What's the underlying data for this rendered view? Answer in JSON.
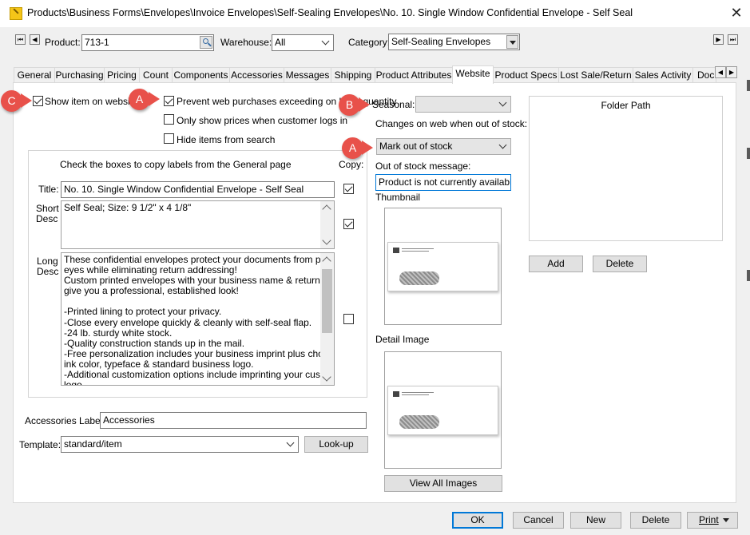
{
  "window": {
    "title": "Products\\Business Forms\\Envelopes\\Invoice Envelopes\\Self-Sealing Envelopes\\No. 10. Single Window Confidential Envelope - Self Seal"
  },
  "toolbar": {
    "product_label": "Product:",
    "product_value": "713-1",
    "warehouse_label": "Warehouse:",
    "warehouse_value": "All",
    "category_label": "Category:",
    "category_value": "Self-Sealing Envelopes"
  },
  "tabs": [
    {
      "label": "General"
    },
    {
      "label": "Purchasing"
    },
    {
      "label": "Pricing"
    },
    {
      "label": "Count"
    },
    {
      "label": "Components"
    },
    {
      "label": "Accessories"
    },
    {
      "label": "Messages"
    },
    {
      "label": "Shipping"
    },
    {
      "label": "Product Attributes"
    },
    {
      "label": "Website",
      "active": true
    },
    {
      "label": "Product Specs"
    },
    {
      "label": "Lost Sale/Return"
    },
    {
      "label": "Sales Activity"
    },
    {
      "label": "Doc"
    }
  ],
  "website": {
    "show_item": {
      "label": "Show item on website",
      "checked": true
    },
    "prevent_purchases": {
      "label": "Prevent web purchases exceeding on hand quantity",
      "checked": true
    },
    "only_prices": {
      "label": "Only show prices when customer logs in",
      "checked": false
    },
    "hide_search": {
      "label": "Hide items from search",
      "checked": false
    },
    "copy_header": "Check the boxes to copy labels from the General page",
    "copy_label": "Copy:",
    "title_label": "Title:",
    "title_value": "No. 10. Single Window Confidential Envelope - Self Seal",
    "title_copy": true,
    "short_desc_label_1": "Short",
    "short_desc_label_2": "Desc",
    "short_desc_value": "Self Seal; Size: 9 1/2\" x 4 1/8\"",
    "short_desc_copy": true,
    "long_desc_label_1": "Long",
    "long_desc_label_2": "Desc",
    "long_desc_lines": [
      "These confidential envelopes protect your documents from prying",
      "eyes while eliminating return addressing!",
      "Custom printed envelopes with your business name & return address",
      "give you a professional, established look!",
      "",
      "-Printed lining to protect your privacy.",
      "-Close every envelope quickly & cleanly with self-seal flap.",
      "-24 lb. sturdy white stock.",
      "-Quality construction stands up in the mail.",
      "-Free personalization includes your business imprint plus choice of",
      "ink color, typeface & standard business logo.",
      "-Additional customization options include imprinting your custom",
      "logo"
    ],
    "long_desc_copy": false,
    "accessories_label": "Accessories Label:",
    "accessories_value": "Accessories",
    "template_label": "Template:",
    "template_value": "standard/item",
    "lookup_button": "Look-up",
    "seasonal_label": "Seasonal:",
    "seasonal_value": "",
    "oos_change_label": "Changes on web when out of stock:",
    "oos_change_value": "Mark out of stock",
    "oos_message_label": "Out of stock message:",
    "oos_message_value": "Product is not currently available",
    "thumbnail_label": "Thumbnail",
    "detail_image_label": "Detail Image",
    "view_all_button": "View All Images",
    "folder_path_header": "Folder Path",
    "add_button": "Add",
    "delete_folder_button": "Delete"
  },
  "annotations": {
    "c": "C",
    "a1": "A",
    "b": "B",
    "a2": "A",
    "color": "#e8514a"
  },
  "footer": {
    "ok": "OK",
    "cancel": "Cancel",
    "new": "New",
    "delete": "Delete",
    "print": "Print"
  }
}
